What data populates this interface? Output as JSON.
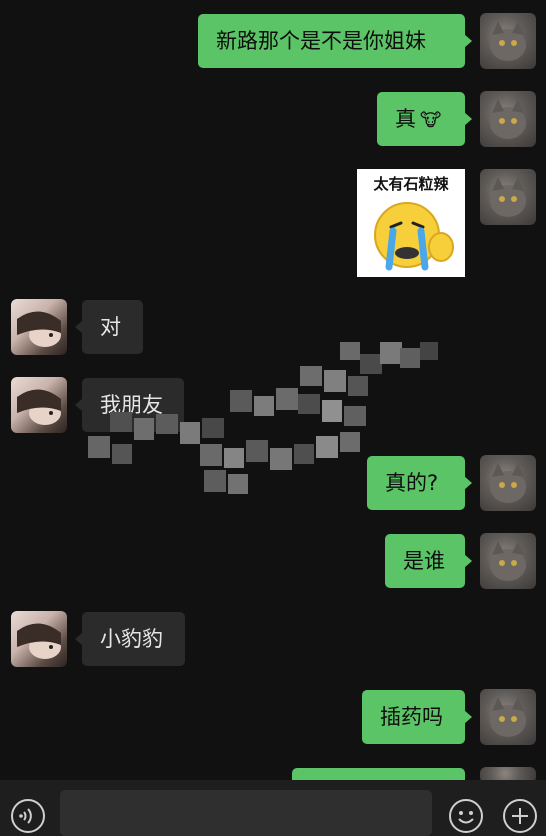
{
  "messages": [
    {
      "side": "out",
      "text": "新路那个是不是你姐妹"
    },
    {
      "side": "out",
      "text": "真",
      "emoji": "🐮"
    },
    {
      "side": "out",
      "type": "sticker",
      "caption": "太有石粒辣"
    },
    {
      "side": "in",
      "text": "对"
    },
    {
      "side": "in",
      "text": "我朋友"
    },
    {
      "side": "out",
      "text": "真的?"
    },
    {
      "side": "out",
      "text": "是谁"
    },
    {
      "side": "in",
      "text": "小豹豹"
    },
    {
      "side": "out",
      "text": "插药吗"
    }
  ],
  "input_bar": {
    "voice_icon": "voice-icon",
    "emoji_icon": "emoji-icon",
    "plus_icon": "plus-icon"
  },
  "colors": {
    "outgoing_bubble": "#5bc466",
    "incoming_bubble": "#2b2b2b",
    "background": "#111111"
  }
}
